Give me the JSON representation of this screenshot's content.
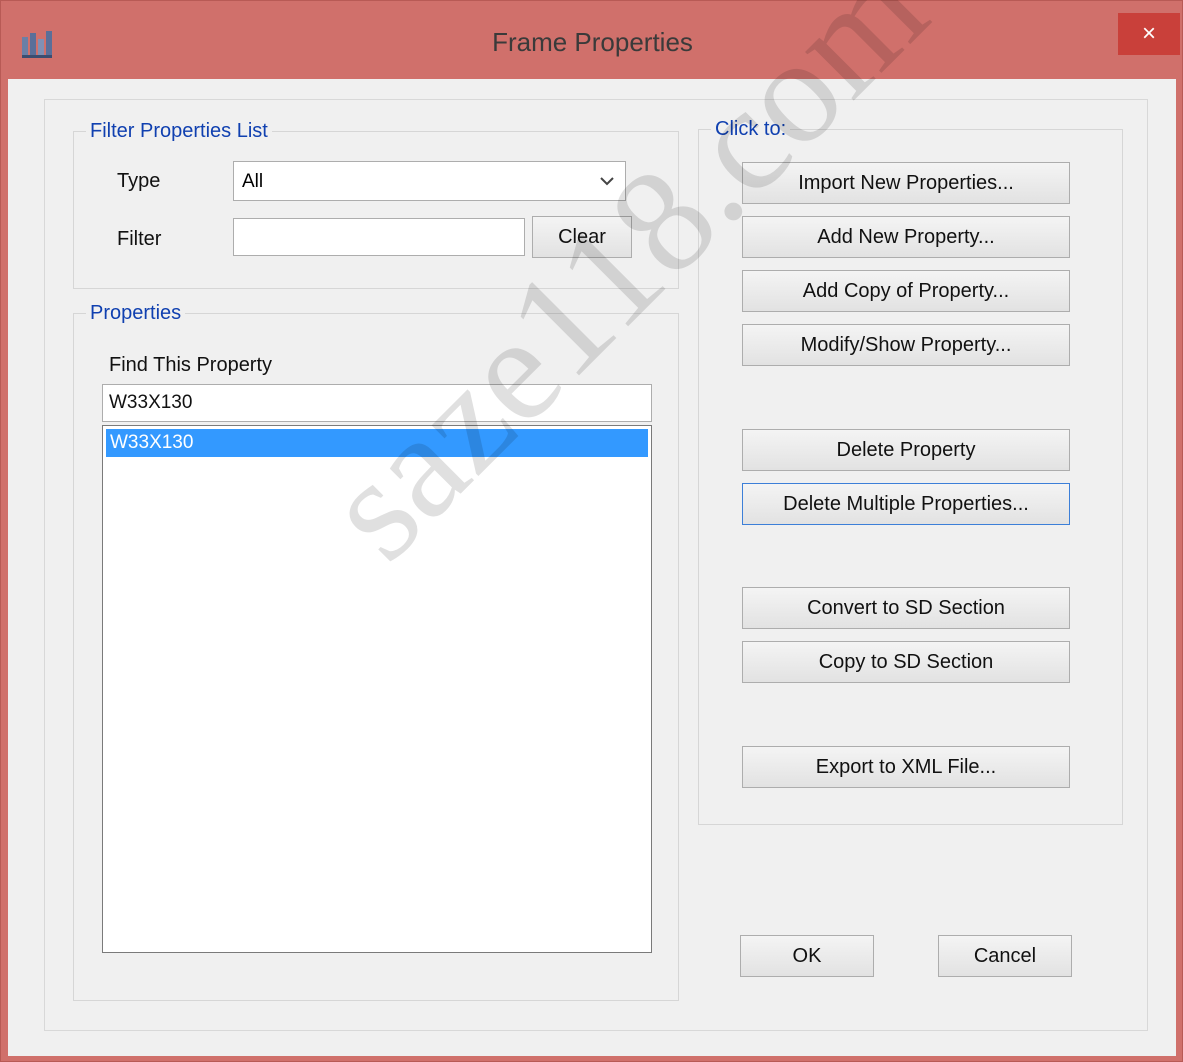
{
  "window": {
    "title": "Frame Properties",
    "close_label": "×"
  },
  "filter_group": {
    "title": "Filter Properties List",
    "type_label": "Type",
    "type_value": "All",
    "filter_label": "Filter",
    "filter_value": "",
    "clear_label": "Clear"
  },
  "properties_group": {
    "title": "Properties",
    "find_label": "Find This Property",
    "find_value": "W33X130",
    "items": [
      "W33X130"
    ]
  },
  "actions_group": {
    "title": "Click to:",
    "import_label": "Import New Properties...",
    "add_new_label": "Add New Property...",
    "add_copy_label": "Add Copy of Property...",
    "modify_label": "Modify/Show Property...",
    "delete_label": "Delete Property",
    "delete_multiple_label": "Delete Multiple Properties...",
    "convert_sd_label": "Convert to SD Section",
    "copy_sd_label": "Copy to SD Section",
    "export_xml_label": "Export to XML File..."
  },
  "dialog_buttons": {
    "ok_label": "OK",
    "cancel_label": "Cancel"
  },
  "watermark": "saze118.com",
  "colors": {
    "title_bar": "#d0706b",
    "close_button": "#c9403a",
    "group_title": "#1040b0",
    "selection": "#3399ff"
  },
  "icons": {
    "app": "frame-sections-app-icon",
    "close": "close-icon",
    "dropdown": "chevron-down-icon"
  }
}
